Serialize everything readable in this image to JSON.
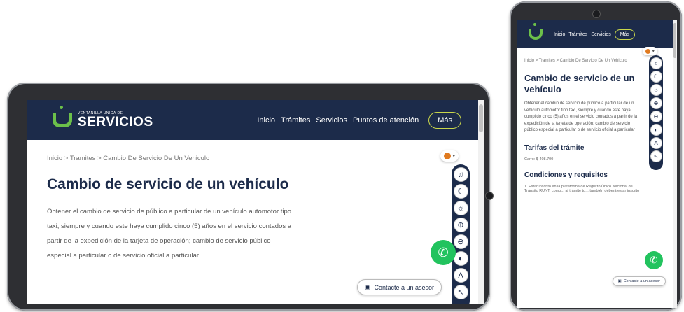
{
  "site": {
    "logo_small": "VENTANILLA ÚNICA DE",
    "logo_big": "SERVICIOS"
  },
  "nav": {
    "inicio": "Inicio",
    "tramites": "Trámites",
    "servicios": "Servicios",
    "puntos": "Puntos de atención",
    "mas": "Más"
  },
  "breadcrumb": {
    "text": "Inicio  >  Tramites  >  Cambio De Servicio De Un Vehiculo"
  },
  "page": {
    "title": "Cambio de servicio de un vehículo",
    "description": "Obtener el cambio de servicio de público a particular de un vehículo automotor tipo taxi, siempre y cuando este haya cumplido cinco (5) años en el servicio contados a partir de la expedición de la tarjeta de operación; cambio de servicio público especial a particular o de servicio oficial a particular",
    "tarifas_heading": "Tarifas del trámite",
    "tarifas_value": "Carro: $ 408.700",
    "condiciones_heading": "Condiciones y requisitos",
    "condiciones_text": "1. Estar inscrito en la plataforma de Registro Único Nacional de Tránsito RUNT. como... al trámite tu... también deberá estar inscrito"
  },
  "widgets": {
    "advisor_label": "Contacte a un asesor",
    "a11y_buttons": [
      "audio-icon",
      "contrast-icon",
      "brightness-icon",
      "zoom-icon",
      "zoom-out-icon",
      "grayscale-icon",
      "font-icon",
      "cursor-icon"
    ]
  },
  "colors": {
    "navy": "#1c2b4a",
    "green": "#6cc04a",
    "whatsapp": "#22c35e",
    "mas_border": "#c9d64a"
  }
}
